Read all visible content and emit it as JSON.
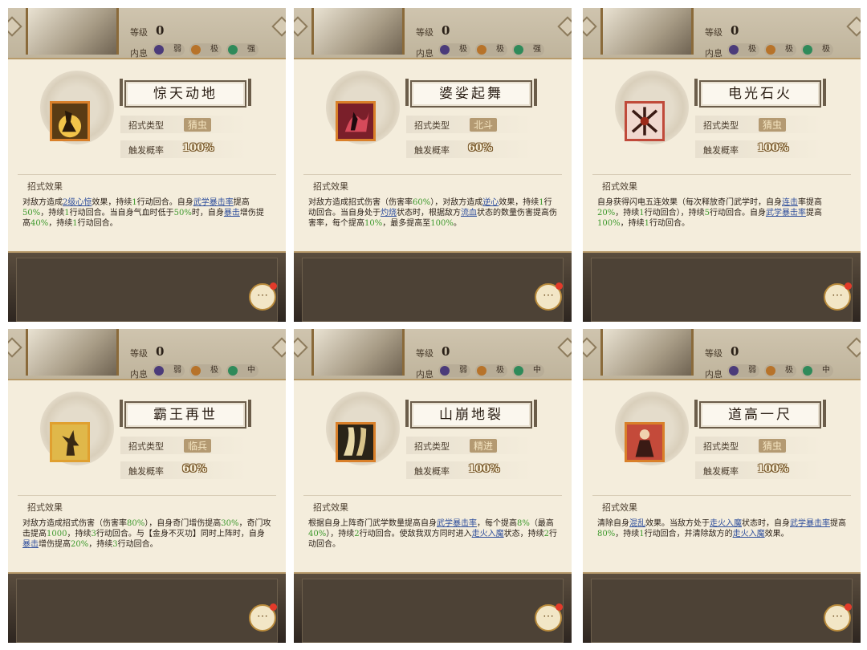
{
  "labels": {
    "level": "等级",
    "neixi": "内息",
    "type": "招式类型",
    "rate": "触发概率",
    "effect": "招式效果"
  },
  "colors": {
    "accent": "#d9802a",
    "green_text": "#3f9a2e",
    "blue_link": "#2f4f9c"
  },
  "panels": [
    {
      "level": "0",
      "badges": [
        "弱",
        "极",
        "强"
      ],
      "name": "惊天动地",
      "type": "猜虫",
      "rate": "100%",
      "icon": "golden-warrior-icon",
      "effect": [
        {
          "t": "对敌方造成"
        },
        {
          "t": "2级心惊",
          "c": "b"
        },
        {
          "t": "效果，持续"
        },
        {
          "t": "1",
          "c": "g"
        },
        {
          "t": "行动回合。自身"
        },
        {
          "t": "武学暴击率",
          "c": "b"
        },
        {
          "t": "提高"
        },
        {
          "t": "50%",
          "c": "g"
        },
        {
          "t": "，持续"
        },
        {
          "t": "1",
          "c": "g"
        },
        {
          "t": "行动回合。当自身气血时低于"
        },
        {
          "t": "50%",
          "c": "g"
        },
        {
          "t": "时，自身"
        },
        {
          "t": "暴击",
          "c": "b"
        },
        {
          "t": "增伤提高"
        },
        {
          "t": "40%",
          "c": "g"
        },
        {
          "t": "，持续"
        },
        {
          "t": "1",
          "c": "g"
        },
        {
          "t": "行动回合。"
        }
      ]
    },
    {
      "level": "0",
      "badges": [
        "极",
        "极",
        "强"
      ],
      "name": "婆娑起舞",
      "type": "北斗",
      "rate": "60%",
      "icon": "crimson-dancer-icon",
      "effect": [
        {
          "t": "对敌方造成招式伤害（伤害率"
        },
        {
          "t": "60%",
          "c": "g"
        },
        {
          "t": "），对敌方造成"
        },
        {
          "t": "逆心",
          "c": "b"
        },
        {
          "t": "效果，持续"
        },
        {
          "t": "1",
          "c": "g"
        },
        {
          "t": "行动回合。当自身处于"
        },
        {
          "t": "灼烧",
          "c": "b"
        },
        {
          "t": "状态时，根据敌方"
        },
        {
          "t": "流血",
          "c": "b"
        },
        {
          "t": "状态的数量伤害提高伤害率，每个提高"
        },
        {
          "t": "10%",
          "c": "g"
        },
        {
          "t": "，最多提高至"
        },
        {
          "t": "100%",
          "c": "g"
        },
        {
          "t": "。"
        }
      ]
    },
    {
      "level": "0",
      "badges": [
        "极",
        "极",
        "极"
      ],
      "name": "电光石火",
      "type": "猜虫",
      "rate": "100%",
      "icon": "red-slash-icon",
      "effect": [
        {
          "t": "自身获得闪电五连效果（每次释放奇门武学时，自身"
        },
        {
          "t": "连击",
          "c": "b"
        },
        {
          "t": "率提高"
        },
        {
          "t": "20%",
          "c": "g"
        },
        {
          "t": "，持续"
        },
        {
          "t": "1",
          "c": "g"
        },
        {
          "t": "行动回合），持续"
        },
        {
          "t": "5",
          "c": "g"
        },
        {
          "t": "行动回合。自身"
        },
        {
          "t": "武学暴击率",
          "c": "b"
        },
        {
          "t": "提高"
        },
        {
          "t": "100%",
          "c": "g"
        },
        {
          "t": "，持续"
        },
        {
          "t": "1",
          "c": "g"
        },
        {
          "t": "行动回合。"
        }
      ]
    },
    {
      "level": "0",
      "badges": [
        "弱",
        "极",
        "中"
      ],
      "name": "霸王再世",
      "type": "临兵",
      "rate": "60%",
      "icon": "warlord-silhouette-icon",
      "effect": [
        {
          "t": "对敌方造成招式伤害（伤害率"
        },
        {
          "t": "80%",
          "c": "g"
        },
        {
          "t": "），自身奇门增伤提高"
        },
        {
          "t": "30%",
          "c": "g"
        },
        {
          "t": "，奇门攻击提高"
        },
        {
          "t": "1000",
          "c": "g"
        },
        {
          "t": "，持续"
        },
        {
          "t": "3",
          "c": "g"
        },
        {
          "t": "行动回合。与【金身不灭功】同时上阵时，自身"
        },
        {
          "t": "暴击",
          "c": "b"
        },
        {
          "t": "增伤提高"
        },
        {
          "t": "20%",
          "c": "g"
        },
        {
          "t": "，持续"
        },
        {
          "t": "3",
          "c": "g"
        },
        {
          "t": "行动回合。"
        }
      ]
    },
    {
      "level": "0",
      "badges": [
        "弱",
        "极",
        "中"
      ],
      "name": "山崩地裂",
      "type": "精进",
      "rate": "100%",
      "icon": "cracked-earth-icon",
      "effect": [
        {
          "t": "根据自身上阵奇门武学数量提高自身"
        },
        {
          "t": "武学暴击率",
          "c": "b"
        },
        {
          "t": "，每个提高"
        },
        {
          "t": "8%",
          "c": "g"
        },
        {
          "t": "（最高"
        },
        {
          "t": "40%",
          "c": "g"
        },
        {
          "t": "），持续"
        },
        {
          "t": "2",
          "c": "g"
        },
        {
          "t": "行动回合。使敌我双方同时进入"
        },
        {
          "t": "走火入魔",
          "c": "b"
        },
        {
          "t": "状态，持续"
        },
        {
          "t": "2",
          "c": "g"
        },
        {
          "t": "行动回合。"
        }
      ]
    },
    {
      "level": "0",
      "badges": [
        "弱",
        "极",
        "中"
      ],
      "name": "道高一尺",
      "type": "猜虫",
      "rate": "100%",
      "icon": "robed-master-icon",
      "effect": [
        {
          "t": "清除自身"
        },
        {
          "t": "混乱",
          "c": "b"
        },
        {
          "t": "效果。当敌方处于"
        },
        {
          "t": "走火入魔",
          "c": "b"
        },
        {
          "t": "状态时，自身"
        },
        {
          "t": "武学暴击率",
          "c": "b"
        },
        {
          "t": "提高"
        },
        {
          "t": "80%",
          "c": "g"
        },
        {
          "t": "，持续"
        },
        {
          "t": "1",
          "c": "g"
        },
        {
          "t": "行动回合，并清除敌方的"
        },
        {
          "t": "走火入魔",
          "c": "b"
        },
        {
          "t": "效果。"
        }
      ]
    }
  ]
}
